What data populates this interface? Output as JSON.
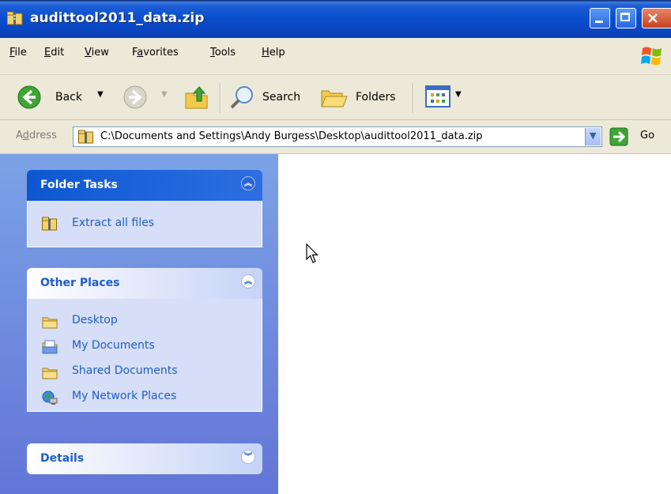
{
  "window": {
    "title": "audittool2011_data.zip"
  },
  "menubar": {
    "items": [
      {
        "pre": "",
        "u": "F",
        "post": "ile"
      },
      {
        "pre": "",
        "u": "E",
        "post": "dit"
      },
      {
        "pre": "",
        "u": "V",
        "post": "iew"
      },
      {
        "pre": "F",
        "u": "a",
        "post": "vorites"
      },
      {
        "pre": "",
        "u": "T",
        "post": "ools"
      },
      {
        "pre": "",
        "u": "H",
        "post": "elp"
      }
    ]
  },
  "toolbar": {
    "back_label": "Back",
    "search_label": "Search",
    "folders_label": "Folders"
  },
  "address": {
    "label_pre": "A",
    "label_u": "d",
    "label_post": "dress",
    "value": "C:\\Documents and Settings\\Andy Burgess\\Desktop\\audittool2011_data.zip",
    "go_label": "Go"
  },
  "folder_tasks": {
    "title": "Folder Tasks",
    "items": [
      {
        "label": "Extract all files",
        "icon": "zip-folder-icon"
      }
    ]
  },
  "other_places": {
    "title": "Other Places",
    "items": [
      {
        "label": "Desktop",
        "icon": "folder-icon"
      },
      {
        "label": "My Documents",
        "icon": "my-documents-icon"
      },
      {
        "label": "Shared Documents",
        "icon": "folder-icon"
      },
      {
        "label": "My Network Places",
        "icon": "network-places-icon"
      }
    ]
  },
  "details": {
    "title": "Details"
  },
  "colors": {
    "titlebar": "#0a4fce",
    "taskpane": "#6f8fdf",
    "panel_body": "#d6dff7",
    "link": "#215dc6"
  }
}
